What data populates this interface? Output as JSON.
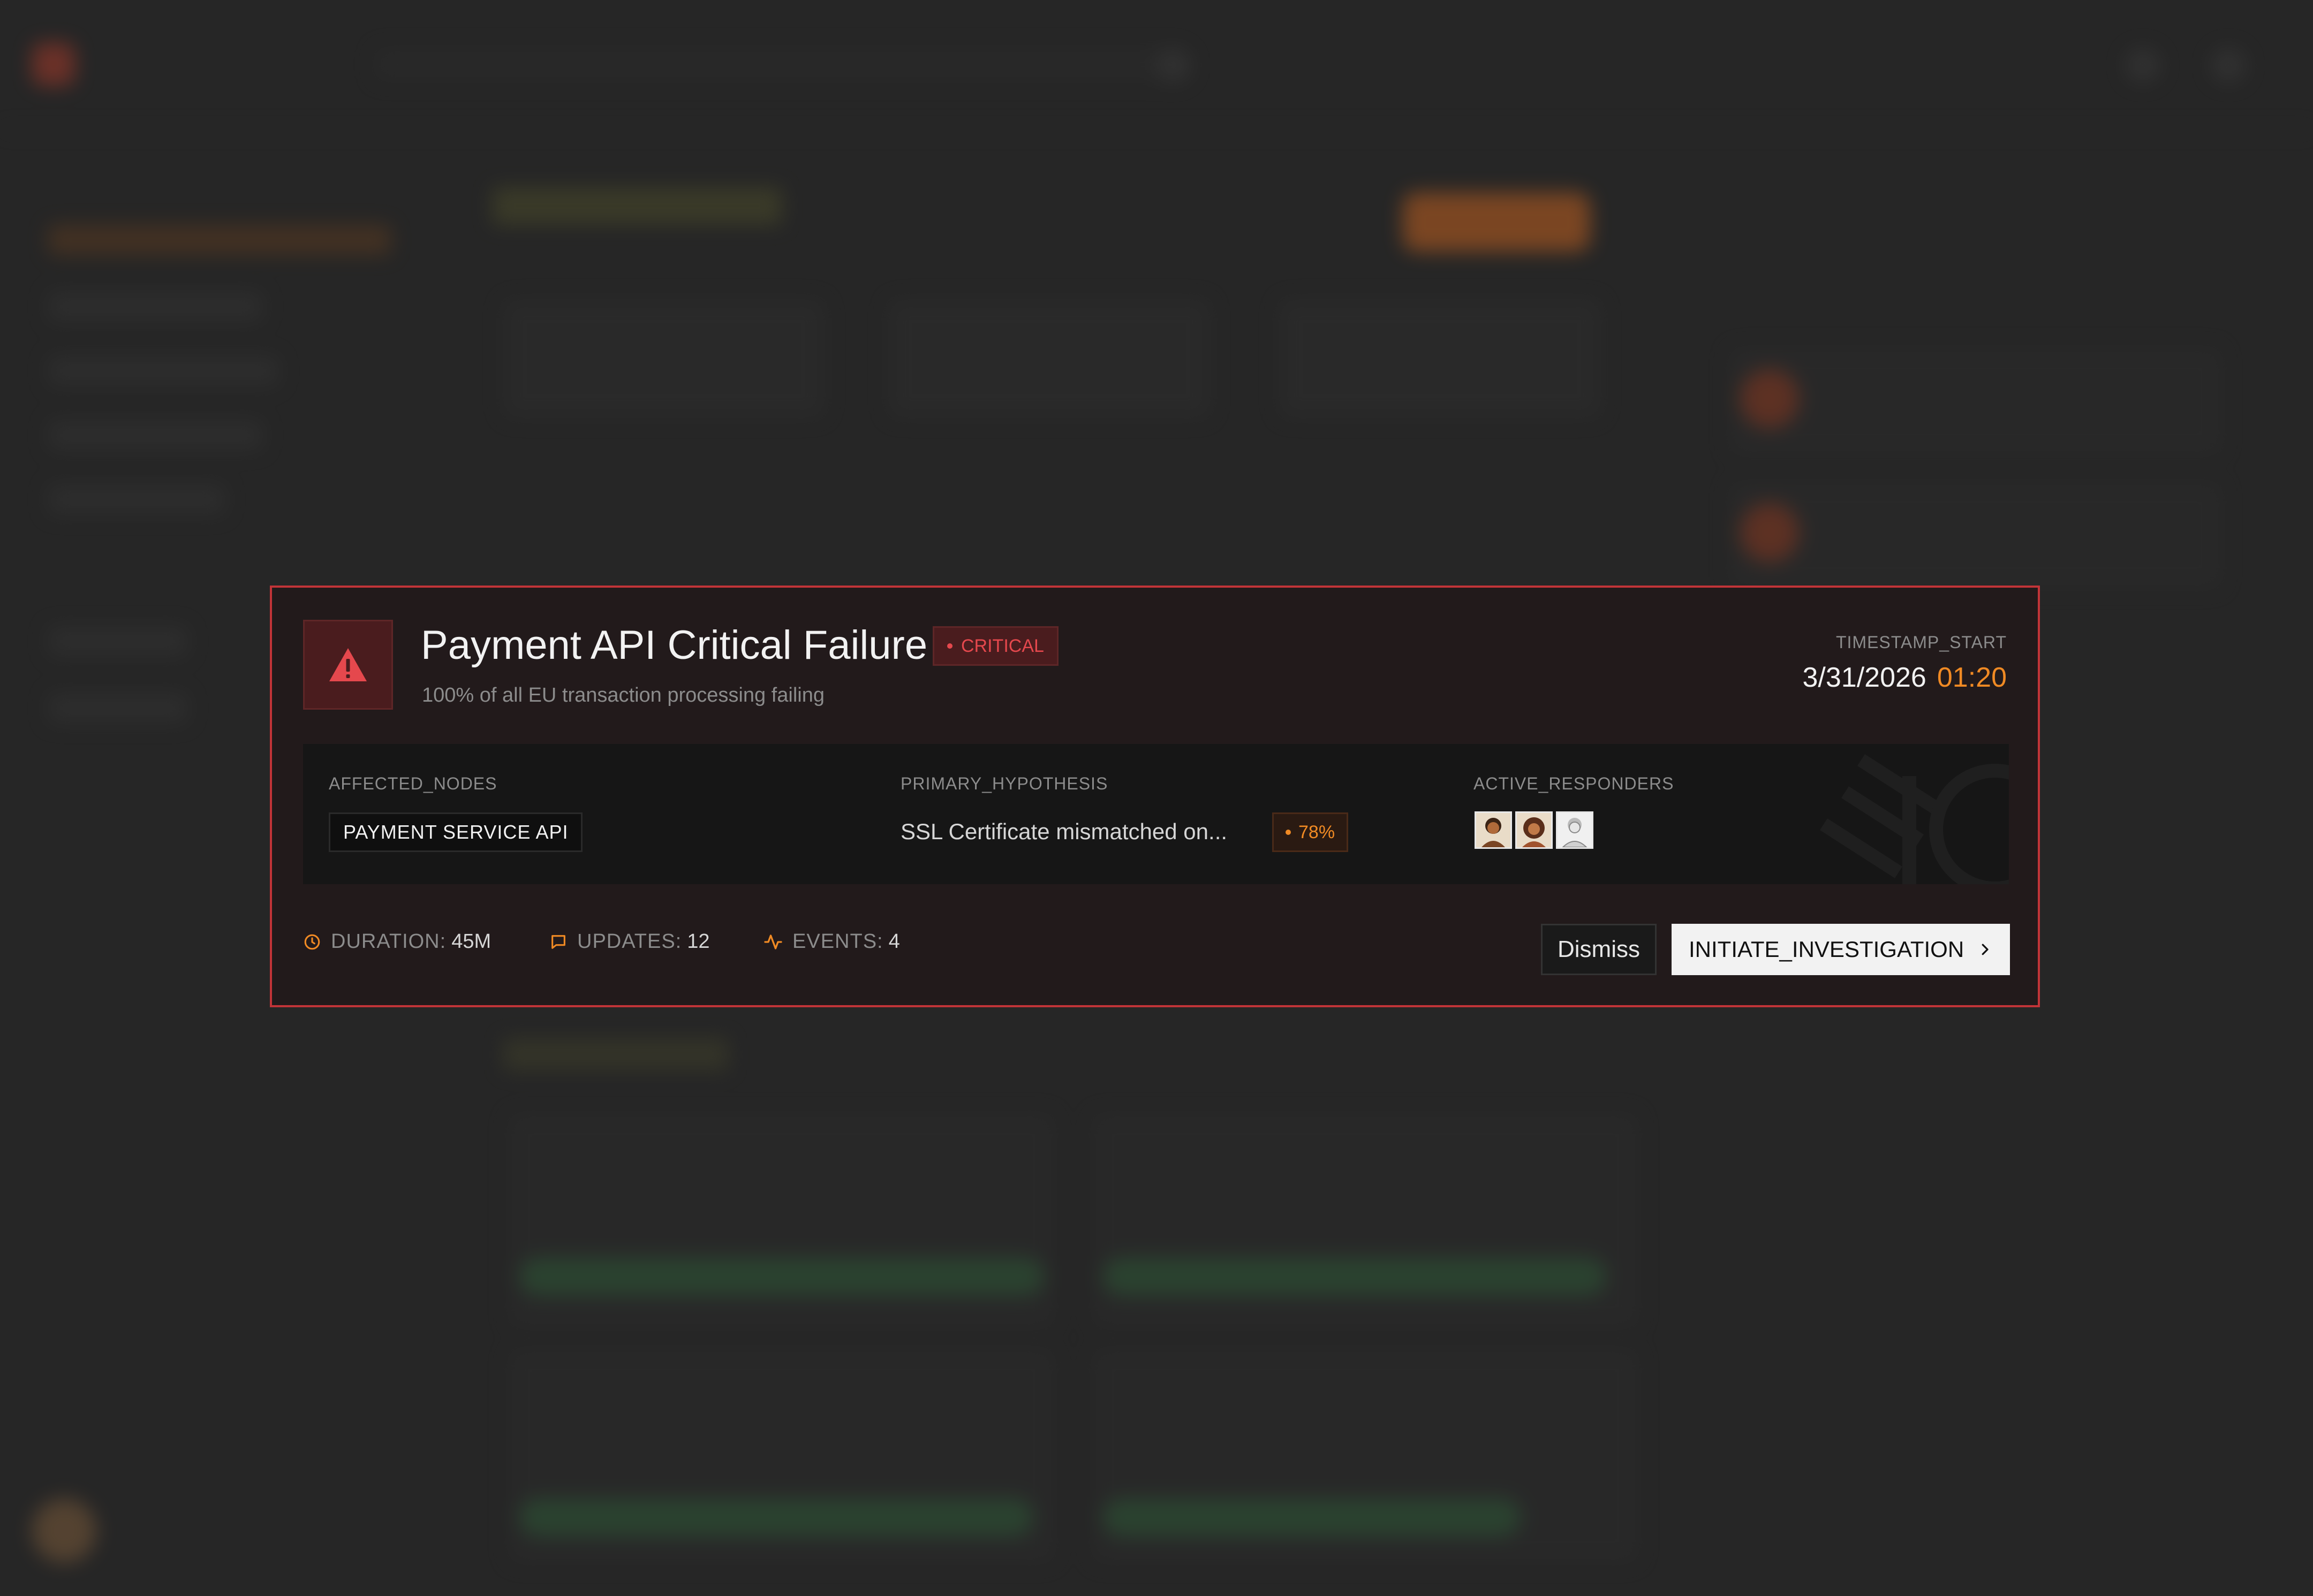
{
  "modal": {
    "title": "Payment API Critical Failure",
    "severity": "CRITICAL",
    "subtitle": "100% of all EU transaction processing failing",
    "timestamp_label": "TIMESTAMP_START",
    "timestamp_date": "3/31/2026",
    "timestamp_time": "01:20",
    "affected_nodes_label": "AFFECTED_NODES",
    "affected_node": "PAYMENT SERVICE API",
    "hypothesis_label": "PRIMARY_HYPOTHESIS",
    "hypothesis": "SSL Certificate mismatched on...",
    "confidence": "78%",
    "responders_label": "ACTIVE_RESPONDERS",
    "duration_label": "DURATION:",
    "duration_value": "45M",
    "updates_label": "UPDATES:",
    "updates_value": "12",
    "events_label": "EVENTS:",
    "events_value": "4",
    "dismiss_label": "Dismiss",
    "primary_label": "INITIATE_INVESTIGATION"
  },
  "colors": {
    "critical": "#e5484d",
    "accent": "#f08a24",
    "modal_border": "#c23438",
    "modal_bg": "#221a1b"
  },
  "icons": {
    "alert": "warning-triangle-icon",
    "duration": "clock-icon",
    "updates": "message-square-icon",
    "events": "activity-icon",
    "primary": "chevron-right-icon"
  }
}
